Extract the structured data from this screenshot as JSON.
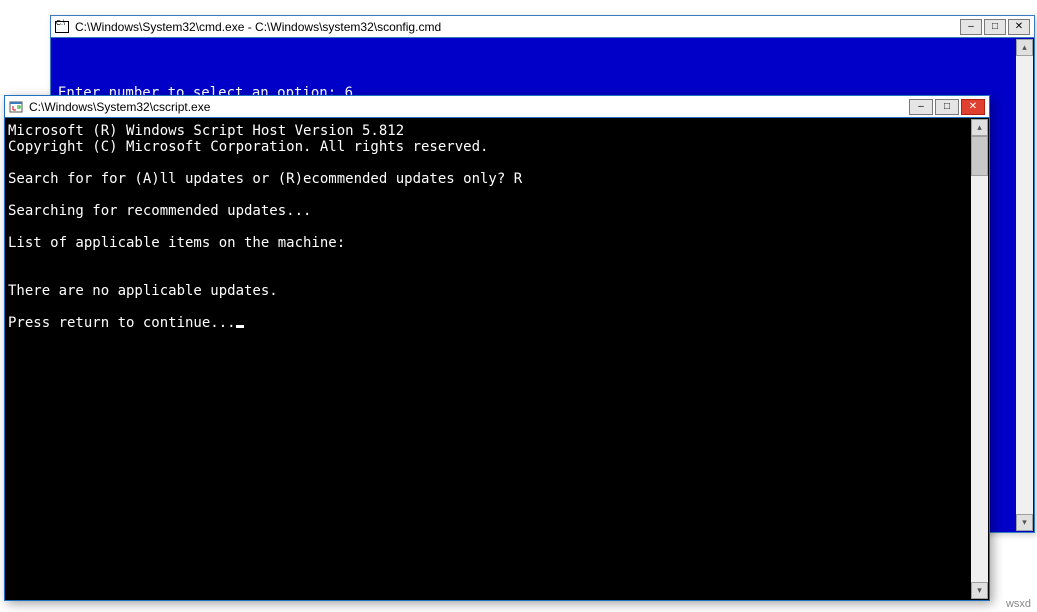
{
  "watermark": "wsxd",
  "back_window": {
    "title": "C:\\Windows\\System32\\cmd.exe - C:\\Windows\\system32\\sconfig.cmd",
    "terminal_line": "Enter number to select an option: 6"
  },
  "front_window": {
    "title": "C:\\Windows\\System32\\cscript.exe",
    "lines": {
      "l0": "Microsoft (R) Windows Script Host Version 5.812",
      "l1": "Copyright (C) Microsoft Corporation. All rights reserved.",
      "l2": "",
      "l3": "Search for for (A)ll updates or (R)ecommended updates only? R",
      "l4": "",
      "l5": "Searching for recommended updates...",
      "l6": "",
      "l7": "List of applicable items on the machine:",
      "l8": "",
      "l9": "",
      "l10": "There are no applicable updates.",
      "l11": "",
      "l12": "Press return to continue..."
    }
  },
  "buttons": {
    "minimize": "–",
    "maximize": "□",
    "close": "✕"
  }
}
